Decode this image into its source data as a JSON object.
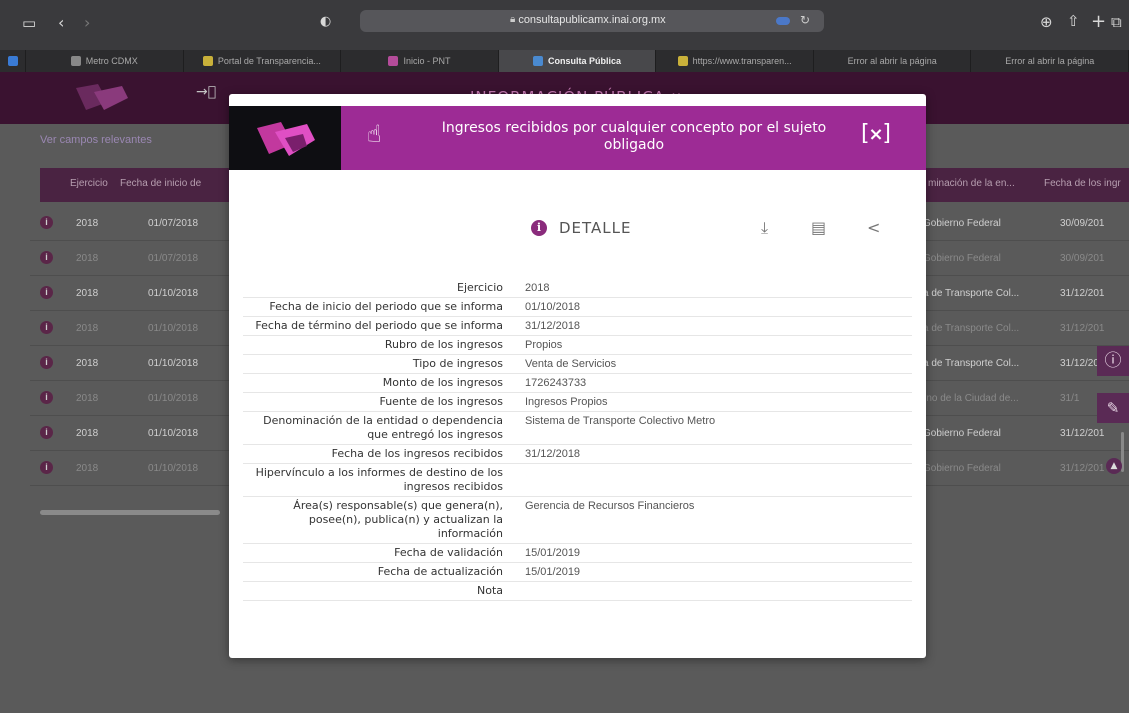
{
  "browser": {
    "url": "consultapublicamx.inai.org.mx",
    "tabs": [
      {
        "label": "Metro CDMX",
        "active": false,
        "fav": "#888888"
      },
      {
        "label": "Portal de Transparencia...",
        "active": false,
        "fav": "#c9b13a"
      },
      {
        "label": "Inicio - PNT",
        "active": false,
        "fav": "#b44c9a"
      },
      {
        "label": "Consulta Pública",
        "active": true,
        "fav": "#4a8ad0"
      },
      {
        "label": "https://www.transparen...",
        "active": false,
        "fav": "#c9b13a"
      },
      {
        "label": "Error al abrir la página",
        "active": false,
        "fav": ""
      },
      {
        "label": "Error al abrir la página",
        "active": false,
        "fav": ""
      }
    ]
  },
  "page": {
    "header_title": "INFORMACIÓN PÚBLICA ∨",
    "ver_campos": "Ver campos relevantes",
    "columns": [
      "Ejercicio",
      "Fecha de inicio de",
      "minación de la en...",
      "Fecha de los ingr"
    ],
    "rows": [
      {
        "ejercicio": "2018",
        "inicio": "01/07/2018",
        "entidad": "Gobierno Federal",
        "fecha": "30/09/201",
        "shade": "dark"
      },
      {
        "ejercicio": "2018",
        "inicio": "01/07/2018",
        "entidad": "Gobierno Federal",
        "fecha": "30/09/201",
        "shade": "light"
      },
      {
        "ejercicio": "2018",
        "inicio": "01/10/2018",
        "entidad": "a de Transporte Col...",
        "fecha": "31/12/201",
        "shade": "dark"
      },
      {
        "ejercicio": "2018",
        "inicio": "01/10/2018",
        "entidad": "a de Transporte Col...",
        "fecha": "31/12/201",
        "shade": "light"
      },
      {
        "ejercicio": "2018",
        "inicio": "01/10/2018",
        "entidad": "a de Transporte Col...",
        "fecha": "31/12/201",
        "shade": "dark"
      },
      {
        "ejercicio": "2018",
        "inicio": "01/10/2018",
        "entidad": "rno de la Ciudad de...",
        "fecha": "31/1",
        "shade": "light"
      },
      {
        "ejercicio": "2018",
        "inicio": "01/10/2018",
        "entidad": "Gobierno Federal",
        "fecha": "31/12/201",
        "shade": "dark"
      },
      {
        "ejercicio": "2018",
        "inicio": "01/10/2018",
        "entidad": "Gobierno Federal",
        "fecha": "31/12/201",
        "shade": "light"
      }
    ]
  },
  "modal": {
    "title": "Ingresos recibidos por cualquier concepto por el sujeto obligado",
    "close_label": "×",
    "detail_label": "DETALLE",
    "fields": [
      {
        "label": "Ejercicio",
        "value": "2018"
      },
      {
        "label": "Fecha de inicio del periodo que se informa",
        "value": "01/10/2018"
      },
      {
        "label": "Fecha de término del periodo que se informa",
        "value": "31/12/2018"
      },
      {
        "label": "Rubro de los ingresos",
        "value": "Propios"
      },
      {
        "label": "Tipo de ingresos",
        "value": "Venta de Servicios"
      },
      {
        "label": "Monto de los ingresos",
        "value": "1726243733"
      },
      {
        "label": "Fuente de los ingresos",
        "value": "Ingresos Propios"
      },
      {
        "label": "Denominación de la entidad o dependencia que entregó los ingresos",
        "value": "Sistema de Transporte Colectivo Metro"
      },
      {
        "label": "Fecha de los ingresos recibidos",
        "value": "31/12/2018"
      },
      {
        "label": "Hipervínculo a los informes de destino de los ingresos recibidos",
        "value": ""
      },
      {
        "label": "Área(s) responsable(s) que genera(n), posee(n), publica(n) y actualizan la información",
        "value": "Gerencia de Recursos Financieros"
      },
      {
        "label": "Fecha de validación",
        "value": "15/01/2019"
      },
      {
        "label": "Fecha de actualización",
        "value": "15/01/2019"
      },
      {
        "label": "Nota",
        "value": ""
      }
    ]
  },
  "icons": {
    "sidebar": "sidebar-icon",
    "back": "chevron-left-icon",
    "forward": "chevron-right-icon",
    "shield": "privacy-shield-icon",
    "download": "download-icon",
    "print": "print-icon",
    "share": "share-icon",
    "plus": "plus-icon",
    "tabs": "tabs-icon"
  },
  "colors": {
    "accent": "#9d2b95",
    "header_dark": "#0e0e12",
    "info_icon": "#8a2b7c"
  }
}
